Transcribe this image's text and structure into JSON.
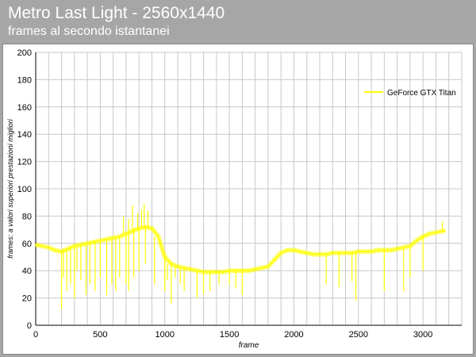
{
  "header": {
    "title": "Metro Last Light - 2560x1440",
    "subtitle": "frames al secondo istantanei"
  },
  "colors": {
    "background": "#a6a6a6",
    "plot_background": "#ffffff",
    "grid": "#c8c8c8",
    "series": "#ffff00"
  },
  "chart_data": {
    "type": "line",
    "title": "Metro Last Light - 2560x1440",
    "subtitle": "frames al secondo istantanei",
    "xlabel": "frame",
    "ylabel": "frames: a valori superiori prestazioni migliori",
    "xlim": [
      0,
      3300
    ],
    "ylim": [
      0,
      200
    ],
    "xticks": [
      0,
      500,
      1000,
      1500,
      2000,
      2500,
      3000
    ],
    "yticks": [
      0,
      20,
      40,
      60,
      80,
      100,
      120,
      140,
      160,
      180,
      200
    ],
    "grid": true,
    "legend_position": "top-right",
    "series": [
      {
        "name": "GeForce GTX Titan",
        "color": "#ffff00",
        "x": [
          0,
          50,
          100,
          150,
          200,
          250,
          300,
          350,
          400,
          450,
          500,
          550,
          600,
          650,
          700,
          750,
          800,
          850,
          900,
          950,
          1000,
          1050,
          1100,
          1150,
          1200,
          1250,
          1300,
          1350,
          1400,
          1450,
          1500,
          1550,
          1600,
          1650,
          1700,
          1750,
          1800,
          1850,
          1900,
          1950,
          2000,
          2050,
          2100,
          2150,
          2200,
          2250,
          2300,
          2350,
          2400,
          2450,
          2500,
          2550,
          2600,
          2650,
          2700,
          2750,
          2800,
          2850,
          2900,
          2950,
          3000,
          3050,
          3100,
          3150,
          3170
        ],
        "y": [
          59,
          58,
          57,
          55,
          54,
          56,
          58,
          59,
          60,
          61,
          62,
          63,
          64,
          65,
          67,
          69,
          71,
          72,
          71,
          65,
          50,
          45,
          43,
          42,
          41,
          40,
          39,
          39,
          39,
          39,
          40,
          40,
          40,
          40,
          41,
          42,
          43,
          48,
          53,
          55,
          55,
          54,
          53,
          52,
          52,
          52,
          53,
          53,
          53,
          53,
          54,
          54,
          54,
          55,
          55,
          55,
          56,
          57,
          58,
          62,
          65,
          67,
          68,
          69,
          69
        ]
      }
    ],
    "dips": [
      {
        "x": 200,
        "y": 12
      },
      {
        "x": 215,
        "y": 35
      },
      {
        "x": 240,
        "y": 25
      },
      {
        "x": 270,
        "y": 30
      },
      {
        "x": 300,
        "y": 20
      },
      {
        "x": 320,
        "y": 40
      },
      {
        "x": 350,
        "y": 33
      },
      {
        "x": 390,
        "y": 22
      },
      {
        "x": 420,
        "y": 30
      },
      {
        "x": 460,
        "y": 25
      },
      {
        "x": 500,
        "y": 35
      },
      {
        "x": 550,
        "y": 22
      },
      {
        "x": 590,
        "y": 30
      },
      {
        "x": 620,
        "y": 25
      },
      {
        "x": 650,
        "y": 35
      },
      {
        "x": 700,
        "y": 30
      },
      {
        "x": 720,
        "y": 25
      },
      {
        "x": 760,
        "y": 35
      },
      {
        "x": 800,
        "y": 40
      },
      {
        "x": 850,
        "y": 45
      },
      {
        "x": 920,
        "y": 30
      },
      {
        "x": 1000,
        "y": 25
      },
      {
        "x": 1020,
        "y": 33
      },
      {
        "x": 1050,
        "y": 16
      },
      {
        "x": 1080,
        "y": 35
      },
      {
        "x": 1120,
        "y": 30
      },
      {
        "x": 1150,
        "y": 25
      },
      {
        "x": 1250,
        "y": 20
      },
      {
        "x": 1300,
        "y": 23
      },
      {
        "x": 1350,
        "y": 25
      },
      {
        "x": 1420,
        "y": 30
      },
      {
        "x": 1500,
        "y": 30
      },
      {
        "x": 1550,
        "y": 27
      },
      {
        "x": 1600,
        "y": 22
      },
      {
        "x": 2250,
        "y": 30
      },
      {
        "x": 2350,
        "y": 28
      },
      {
        "x": 2450,
        "y": 32
      },
      {
        "x": 2480,
        "y": 18
      },
      {
        "x": 2700,
        "y": 25
      },
      {
        "x": 2850,
        "y": 25
      },
      {
        "x": 2900,
        "y": 35
      },
      {
        "x": 3000,
        "y": 40
      }
    ],
    "spikes": [
      {
        "x": 680,
        "y": 80
      },
      {
        "x": 720,
        "y": 78
      },
      {
        "x": 750,
        "y": 88
      },
      {
        "x": 790,
        "y": 82
      },
      {
        "x": 820,
        "y": 85
      },
      {
        "x": 840,
        "y": 89
      },
      {
        "x": 870,
        "y": 84
      },
      {
        "x": 3150,
        "y": 76
      }
    ]
  }
}
